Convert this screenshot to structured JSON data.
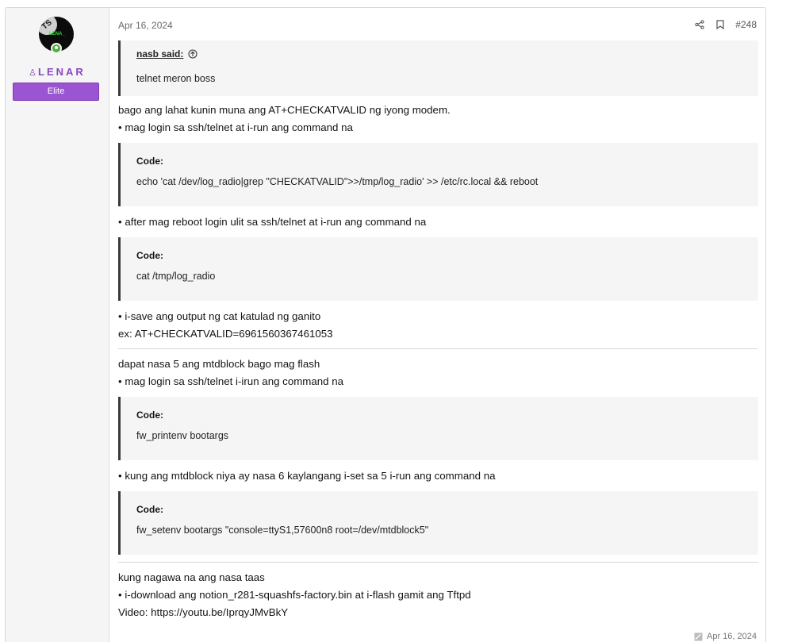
{
  "user": {
    "avatar_lettering": "TS",
    "avatar_sub": "LENA_",
    "username": "LENAR",
    "title": "Elite"
  },
  "post": {
    "date": "Apr 16, 2024",
    "number": "#248",
    "quote": {
      "author": "nasb said:",
      "text": "telnet meron boss"
    },
    "lines": {
      "l1": "bago ang lahat kunin muna ang AT+CHECKATVALID ng iyong modem.",
      "l2": "• mag login sa ssh/telnet at i-run ang command na",
      "l3": "• after mag reboot login ulit sa ssh/telnet at i-run ang command na",
      "l4": "• i-save ang output ng cat katulad ng ganito",
      "l5": "ex: AT+CHECKATVALID=6961560367461053",
      "l6": "dapat nasa 5 ang mtdblock bago mag flash",
      "l7": "• mag login sa ssh/telnet i-irun ang command na",
      "l8": "• kung ang mtdblock niya ay nasa 6 kaylangang i-set sa 5 i-run ang command na",
      "l9": "kung nagawa na ang nasa taas",
      "l10": "• i-download ang notion_r281-squashfs-factory.bin at i-flash gamit ang Tftpd",
      "l11": "Video: https://youtu.be/IprqyJMvBkY"
    },
    "code_title": "Code:",
    "codes": {
      "c1": "echo 'cat /dev/log_radio|grep \"CHECKATVALID\">>/tmp/log_radio' >> /etc/rc.local && reboot",
      "c2": "cat /tmp/log_radio",
      "c3": "fw_printenv bootargs",
      "c4": "fw_setenv bootargs \"console=ttyS1,57600n8 root=/dev/mtdblock5\""
    },
    "footer_date": "Apr 16, 2024"
  },
  "colors": {
    "username": "#8a46c4",
    "badge": "#9b54d2",
    "online": "#4caf3a"
  }
}
